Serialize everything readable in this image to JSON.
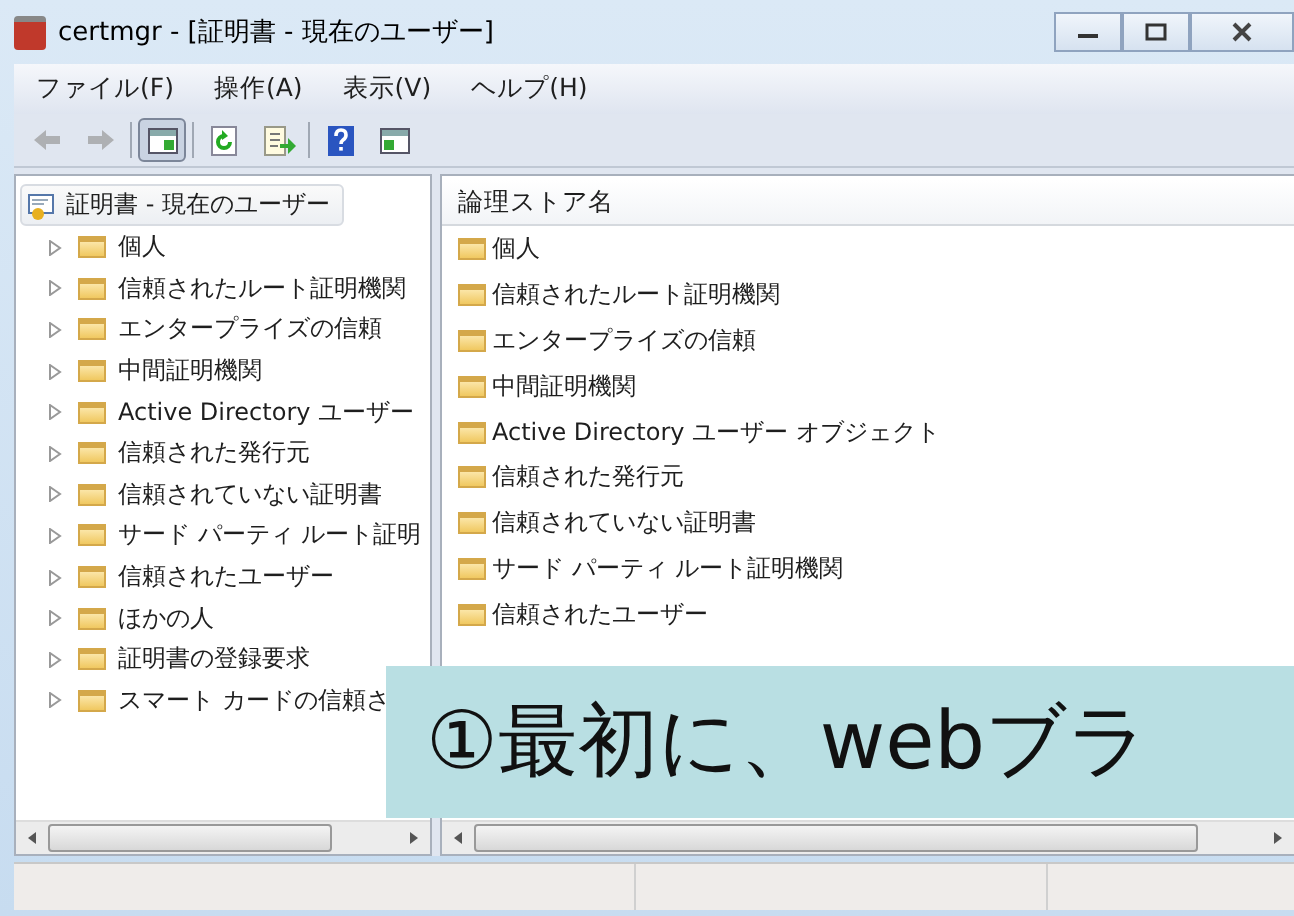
{
  "window": {
    "title": "certmgr - [証明書 - 現在のユーザー]"
  },
  "menu": [
    "ファイル(F)",
    "操作(A)",
    "表示(V)",
    "ヘルプ(H)"
  ],
  "toolbar": [
    {
      "kind": "back",
      "disabled": true
    },
    {
      "kind": "forward",
      "disabled": true
    },
    {
      "kind": "sep"
    },
    {
      "kind": "tree",
      "selected": true
    },
    {
      "kind": "sep"
    },
    {
      "kind": "refresh"
    },
    {
      "kind": "export"
    },
    {
      "kind": "sep"
    },
    {
      "kind": "help"
    },
    {
      "kind": "panel"
    }
  ],
  "tree": {
    "root": "証明書 - 現在のユーザー",
    "children": [
      {
        "label": "個人",
        "expanded": false
      },
      {
        "label": "信頼されたルート証明機関",
        "expanded": false
      },
      {
        "label": "エンタープライズの信頼",
        "expanded": false
      },
      {
        "label": "中間証明機関",
        "expanded": false
      },
      {
        "label": "Active Directory ユーザー",
        "expanded": false
      },
      {
        "label": "信頼された発行元",
        "expanded": false
      },
      {
        "label": "信頼されていない証明書",
        "expanded": false
      },
      {
        "label": "サード パーティ ルート証明",
        "expanded": false
      },
      {
        "label": "信頼されたユーザー",
        "expanded": false
      },
      {
        "label": "ほかの人",
        "expanded": false
      },
      {
        "label": "証明書の登録要求",
        "expanded": false
      },
      {
        "label": "スマート カードの信頼さ",
        "expanded": false
      }
    ]
  },
  "list": {
    "columns": [
      "論理ストア名"
    ],
    "rows": [
      "個人",
      "信頼されたルート証明機関",
      "エンタープライズの信頼",
      "中間証明機関",
      "Active Directory ユーザー オブジェクト",
      "信頼された発行元",
      "信頼されていない証明書",
      "サード パーティ ルート証明機関",
      "信頼されたユーザー"
    ]
  },
  "caption": "①最初に、webブラ"
}
